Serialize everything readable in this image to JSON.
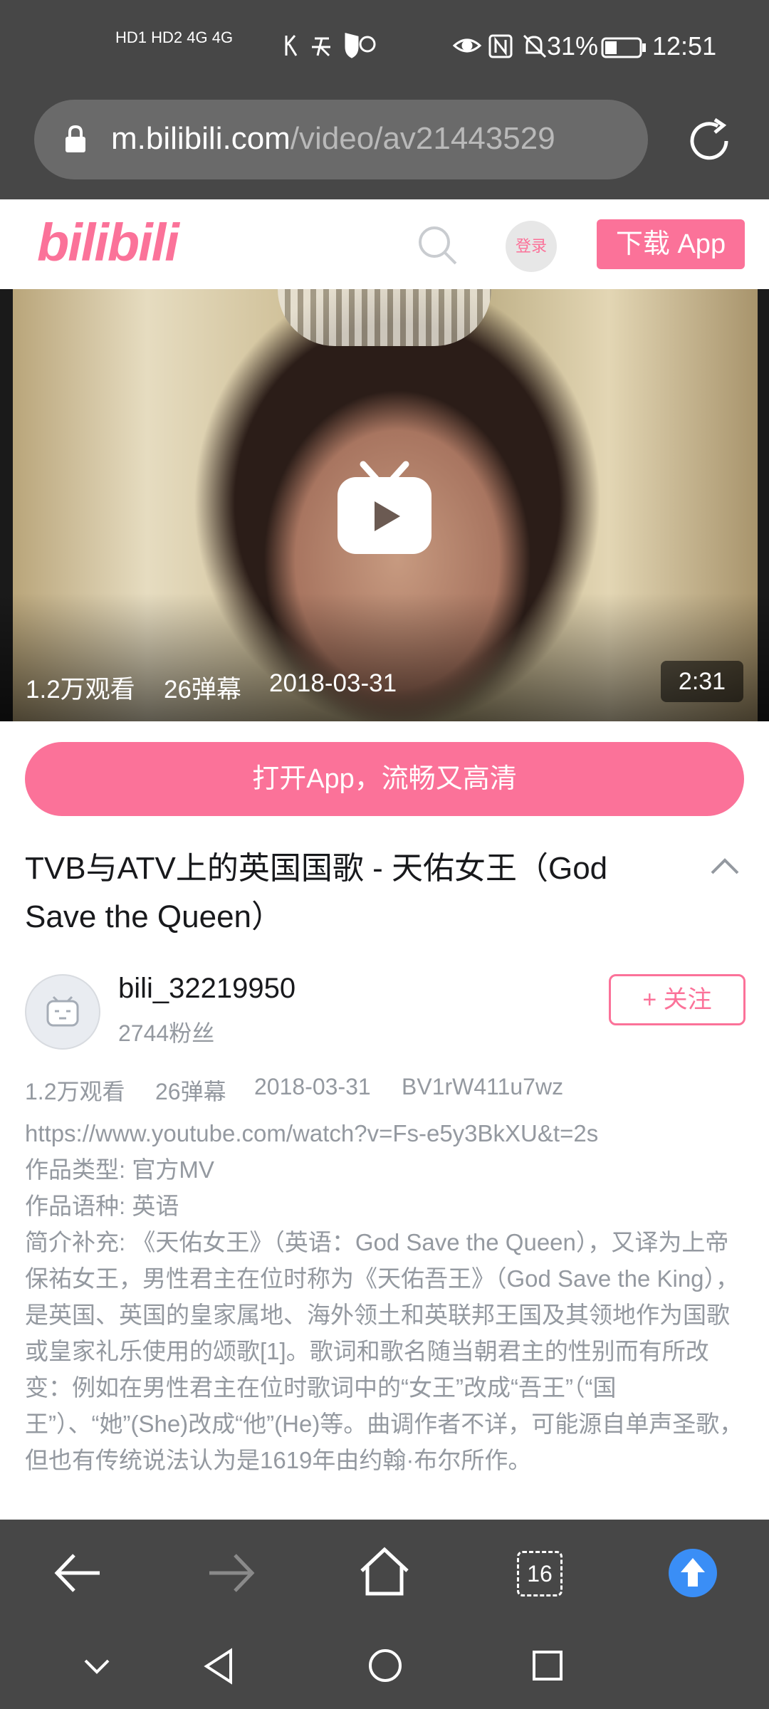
{
  "status_bar": {
    "network_left": "HD1 HD2 4G 4G",
    "battery": "31%",
    "time": "12:51"
  },
  "browser": {
    "url_domain": "m.bilibili.com",
    "url_path": "/video/av21443529",
    "tab_count": "16"
  },
  "header": {
    "logo": "bilibili",
    "login_label": "登录",
    "download_label": "下载 App"
  },
  "video": {
    "views": "1.2万观看",
    "danmaku": "26弹幕",
    "date": "2018-03-31",
    "duration": "2:31"
  },
  "open_app_label": "打开App，流畅又高清",
  "title": "TVB与ATV上的英国国歌 - 天佑女王（God Save the Queen）",
  "uploader": {
    "name": "bili_32219950",
    "fans": "2744粉丝",
    "follow_label": "+ 关注"
  },
  "meta": {
    "views": "1.2万观看",
    "danmaku": "26弹幕",
    "date": "2018-03-31",
    "bvid": "BV1rW411u7wz"
  },
  "description": {
    "line1": "https://www.youtube.com/watch?v=Fs-e5y3BkXU&t=2s",
    "line2": "作品类型: 官方MV",
    "line3": "作品语种: 英语",
    "line4": "简介补充: 《天佑女王》（英语：God Save the Queen），又译为上帝保祐女王，男性君主在位时称为《天佑吾王》（God Save the King），是英国、英国的皇家属地、海外领土和英联邦王国及其领地作为国歌或皇家礼乐使用的颂歌[1]。歌词和歌名随当朝君主的性别而有所改变：例如在男性君主在位时歌词中的“女王”改成“吾王”（“国王”）、“她”(She)改成“他”(He)等。曲调作者不详，可能源自单声圣歌，但也有传统说法认为是1619年由约翰·布尔所作。"
  },
  "colors": {
    "brand_pink": "#fb7299",
    "chrome_gray": "#474747",
    "meta_gray": "#9499a0"
  }
}
